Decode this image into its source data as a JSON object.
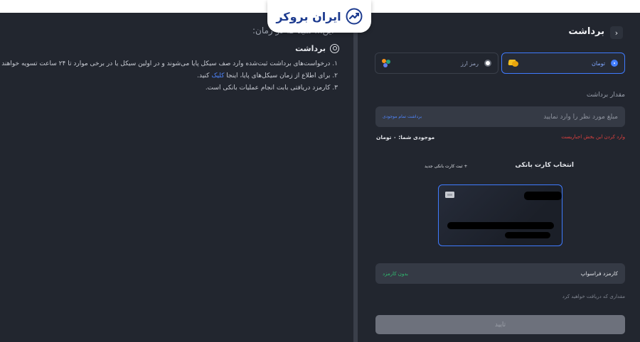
{
  "brand": {
    "name": "ایران بروکر",
    "color": "#1d3b8f"
  },
  "left": {
    "heading": "\"این... شید که در زمان:",
    "subheading": "برداشت",
    "notes": [
      "۱. درخواست‌های برداشت ثبت‌شده وارد صف سیکل پایا می‌شوند و در اولین سیکل یا در برخی موارد تا ۲۴ ساعت تسویه خواهند شد.",
      "۲. برای اطلاع از زمان سیکل‌های پایا، اینجا",
      "کلیک",
      "کنید.",
      "۳. کارمزد دریافتی بابت انجام عملیات بانکی است."
    ]
  },
  "right": {
    "title": "برداشت",
    "back_icon": "chevron-right-icon",
    "currencies": {
      "toman": "تومان",
      "crypto": "رمز ارز"
    },
    "amount_label": "مقدار برداشت",
    "amount_placeholder": "مبلغ مورد نظر را وارد نمایید",
    "withdraw_all": "برداشت تمام موجودی",
    "error": "وارد کردن این بخش اجباریست",
    "balance": "موجودی شما: ۰ تومان",
    "card_section_title": "انتخاب کارت بانکی",
    "add_card": "+ ثبت کارت بانکی جدید",
    "fee_label": "کارمزد فراسواپ",
    "fee_value": "بدون کارمزد",
    "receive_text": "مقداری که دریافت خواهید کرد",
    "confirm_label": "تایید",
    "accent_color": "#3f7bff"
  }
}
